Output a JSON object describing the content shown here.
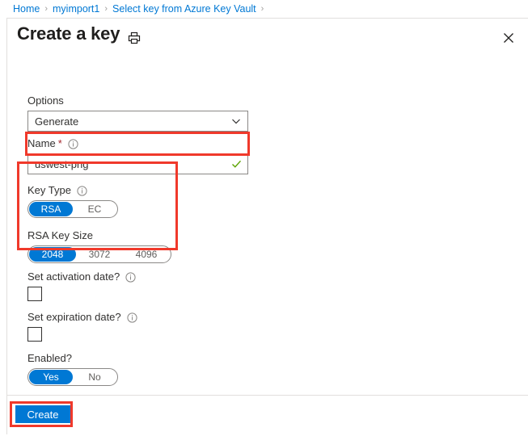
{
  "breadcrumb": {
    "items": [
      {
        "label": "Home"
      },
      {
        "label": "myimport1"
      },
      {
        "label": "Select key from Azure Key Vault"
      }
    ],
    "separator": "›"
  },
  "header": {
    "title": "Create a key",
    "print_icon": "printer-icon",
    "close_icon": "close-icon"
  },
  "form": {
    "options": {
      "label": "Options",
      "value": "Generate",
      "chevron_icon": "chevron-down-icon"
    },
    "name": {
      "label": "Name",
      "required_marker": "*",
      "info_icon": "info-icon",
      "value": "uswest-png",
      "placeholder": "",
      "validation_icon": "green-checkmark-icon"
    },
    "key_type": {
      "label": "Key Type",
      "info_icon": "info-icon",
      "options": [
        "RSA",
        "EC"
      ],
      "selected": "RSA"
    },
    "rsa_key_size": {
      "label": "RSA Key Size",
      "options": [
        "2048",
        "3072",
        "4096"
      ],
      "selected": "2048"
    },
    "set_activation_date": {
      "label": "Set activation date?",
      "info_icon": "info-icon",
      "checked": false
    },
    "set_expiration_date": {
      "label": "Set expiration date?",
      "info_icon": "info-icon",
      "checked": false
    },
    "enabled": {
      "label": "Enabled?",
      "options": [
        "Yes",
        "No"
      ],
      "selected": "Yes"
    }
  },
  "footer": {
    "create_label": "Create"
  },
  "colors": {
    "accent": "#0078d4",
    "link": "#0078d4",
    "highlight": "#f0392b",
    "required": "#a4262c",
    "success": "#5ba300"
  }
}
